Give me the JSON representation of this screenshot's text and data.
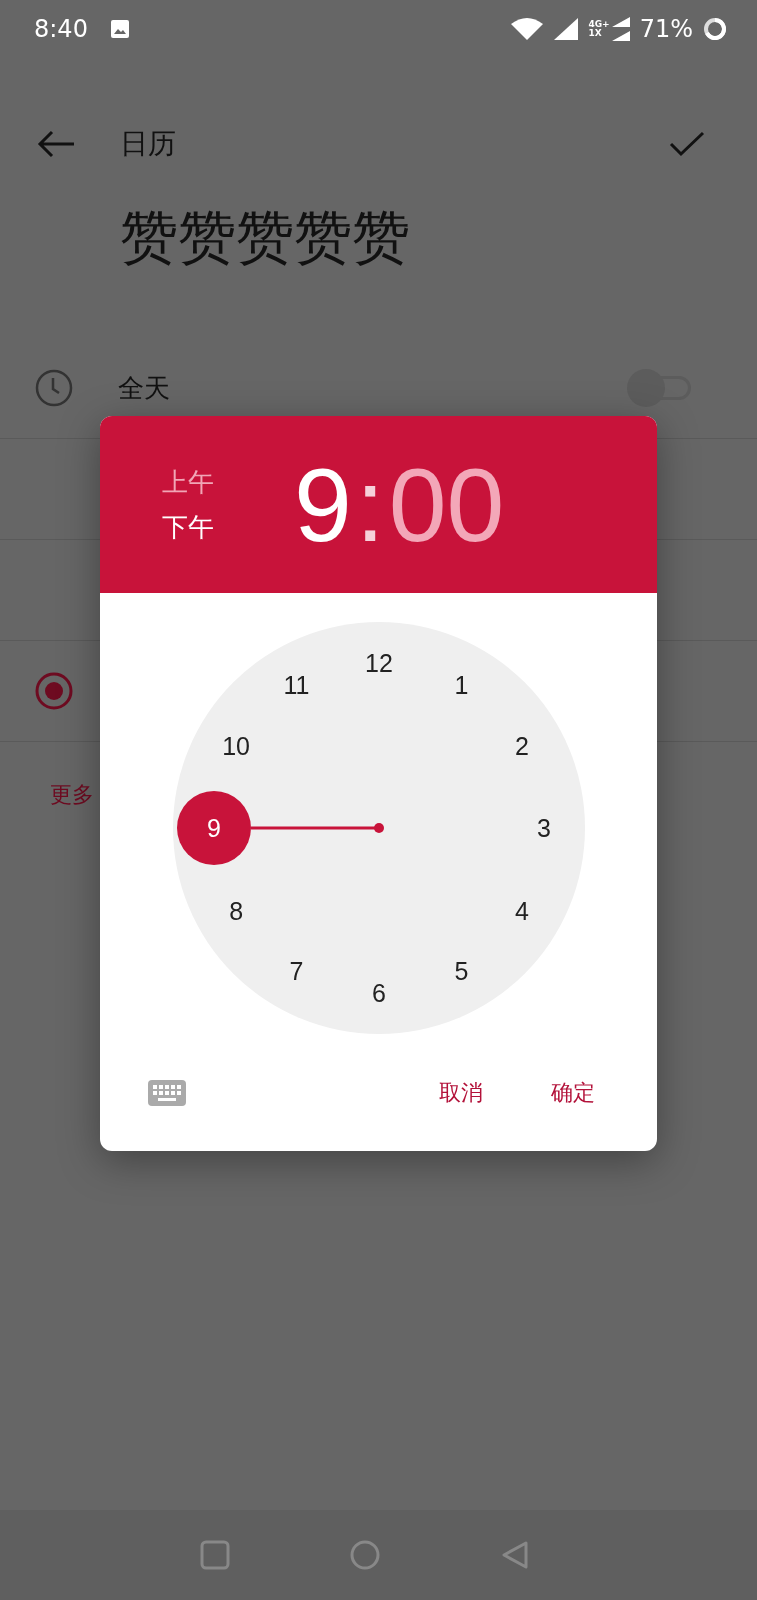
{
  "status_bar": {
    "time": "8:40",
    "network_top": "4G+",
    "network_bottom": "1X",
    "battery": "71%"
  },
  "toolbar": {
    "title": "日历"
  },
  "event_title": "赞赞赞赞赞",
  "all_day": {
    "label": "全天",
    "on": false
  },
  "radio": {
    "selected": true
  },
  "more_link": "更多",
  "time_picker": {
    "periods": [
      {
        "label": "上午",
        "selected": false
      },
      {
        "label": "下午",
        "selected": true
      }
    ],
    "hour": {
      "text": "9",
      "selected": true
    },
    "separator": ":",
    "minute": {
      "text": "00",
      "selected": false
    },
    "dial": [
      {
        "label": "12",
        "selected": false
      },
      {
        "label": "1",
        "selected": false
      },
      {
        "label": "2",
        "selected": false
      },
      {
        "label": "3",
        "selected": false
      },
      {
        "label": "4",
        "selected": false
      },
      {
        "label": "5",
        "selected": false
      },
      {
        "label": "6",
        "selected": false
      },
      {
        "label": "7",
        "selected": false
      },
      {
        "label": "8",
        "selected": false
      },
      {
        "label": "9",
        "selected": true
      },
      {
        "label": "10",
        "selected": false
      },
      {
        "label": "11",
        "selected": false
      }
    ],
    "buttons": [
      {
        "label": "取消"
      },
      {
        "label": "确定"
      }
    ]
  }
}
